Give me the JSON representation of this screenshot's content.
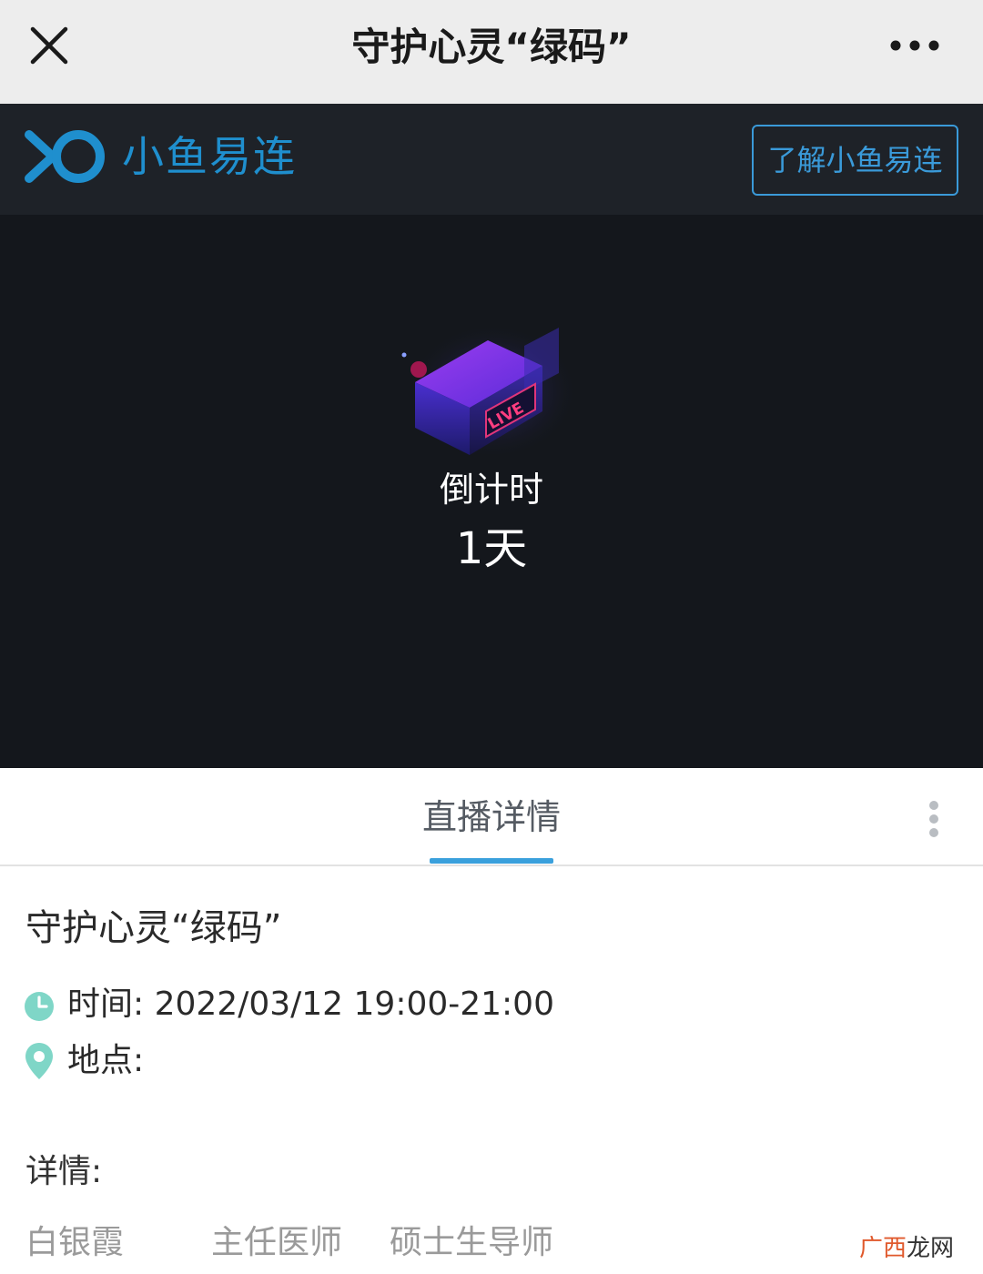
{
  "window": {
    "title": "守护心灵“绿码”",
    "close_icon": "close-icon",
    "more_icon": "more-horizontal-icon"
  },
  "brand": {
    "name": "小鱼易连",
    "learn_button": "了解小鱼易连",
    "accent_color": "#1f8fce"
  },
  "stream": {
    "countdown_label": "倒计时",
    "countdown_value": "1天",
    "badge_text": "LIVE"
  },
  "tabs": [
    {
      "label": "直播详情",
      "active": true
    }
  ],
  "event": {
    "title": "守护心灵“绿码”",
    "time_label": "时间: 2022/03/12 19:00-21:00",
    "location_label": "地点:",
    "details_label": "详情:",
    "speaker": {
      "name": "白银霞",
      "title": "主任医师",
      "role": "硕士生导师"
    },
    "icon_color": "#7fd6c7"
  },
  "watermark": {
    "part_a": "广西",
    "part_b": "龙网"
  }
}
